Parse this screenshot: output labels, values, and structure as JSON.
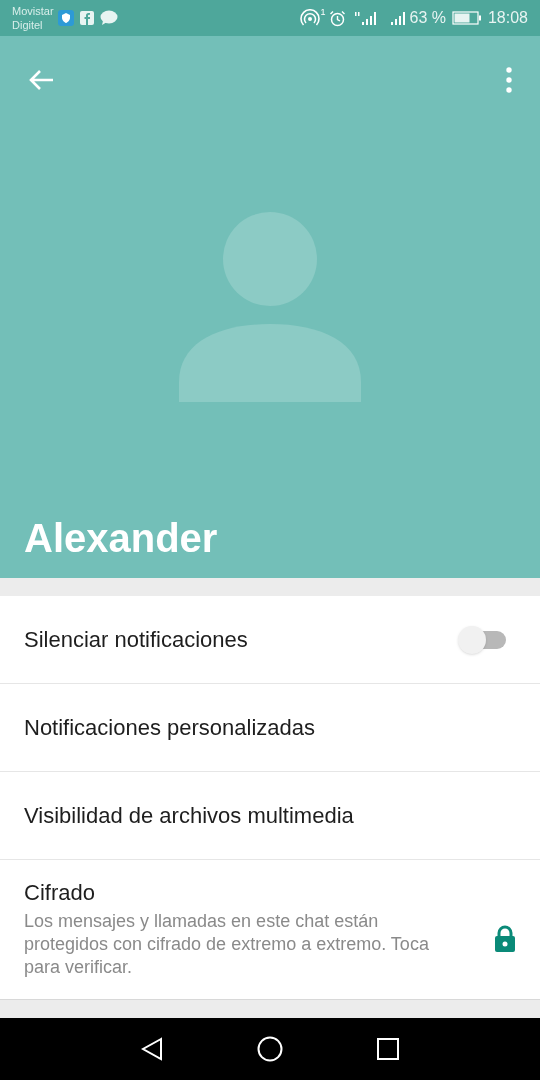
{
  "status_bar": {
    "carrier_lines": [
      "Movistar",
      "Digitel"
    ],
    "hotspot_count": "1",
    "battery_percent": "63 %",
    "time": "18:08"
  },
  "header": {
    "contact_name": "Alexander"
  },
  "settings": [
    {
      "kind": "toggle",
      "label": "Silenciar notificaciones",
      "on": false
    },
    {
      "kind": "plain",
      "label": "Notificaciones personalizadas"
    },
    {
      "kind": "plain",
      "label": "Visibilidad de archivos multimedia"
    },
    {
      "kind": "lock",
      "label": "Cifrado",
      "description": "Los mensajes y llamadas en este chat están protegidos con cifrado de extremo a extremo. Toca para verificar."
    }
  ]
}
